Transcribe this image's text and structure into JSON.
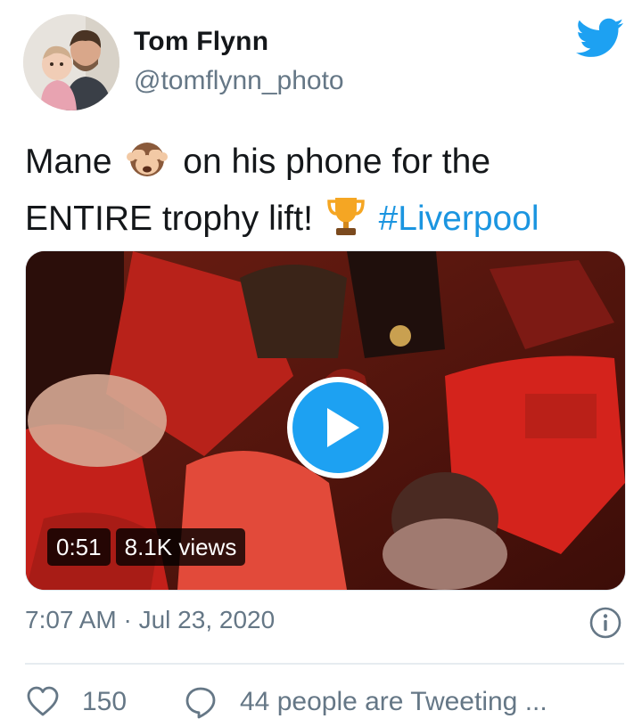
{
  "user": {
    "display_name": "Tom Flynn",
    "handle": "@tomflynn_photo",
    "avatar_icon": "profile-photo"
  },
  "tweet": {
    "line1_before": "Mane",
    "line1_after": "on his phone for the",
    "line2_text": "ENTIRE trophy lift!",
    "hashtag": "#Liverpool",
    "emojis": [
      "see-no-evil-monkey",
      "trophy"
    ]
  },
  "media": {
    "duration": "0:51",
    "views": "8.1K views",
    "play_icon": "play-icon"
  },
  "meta": {
    "timestamp": "7:07 AM · Jul 23, 2020",
    "info_icon": "info-icon"
  },
  "actions": {
    "likes": "150",
    "replies_text": "44 people are Tweeting ..."
  },
  "colors": {
    "twitter_blue": "#1da1f2",
    "hashtag": "#1b95e0",
    "secondary_text": "#657786",
    "divider": "#e6ecf0"
  }
}
